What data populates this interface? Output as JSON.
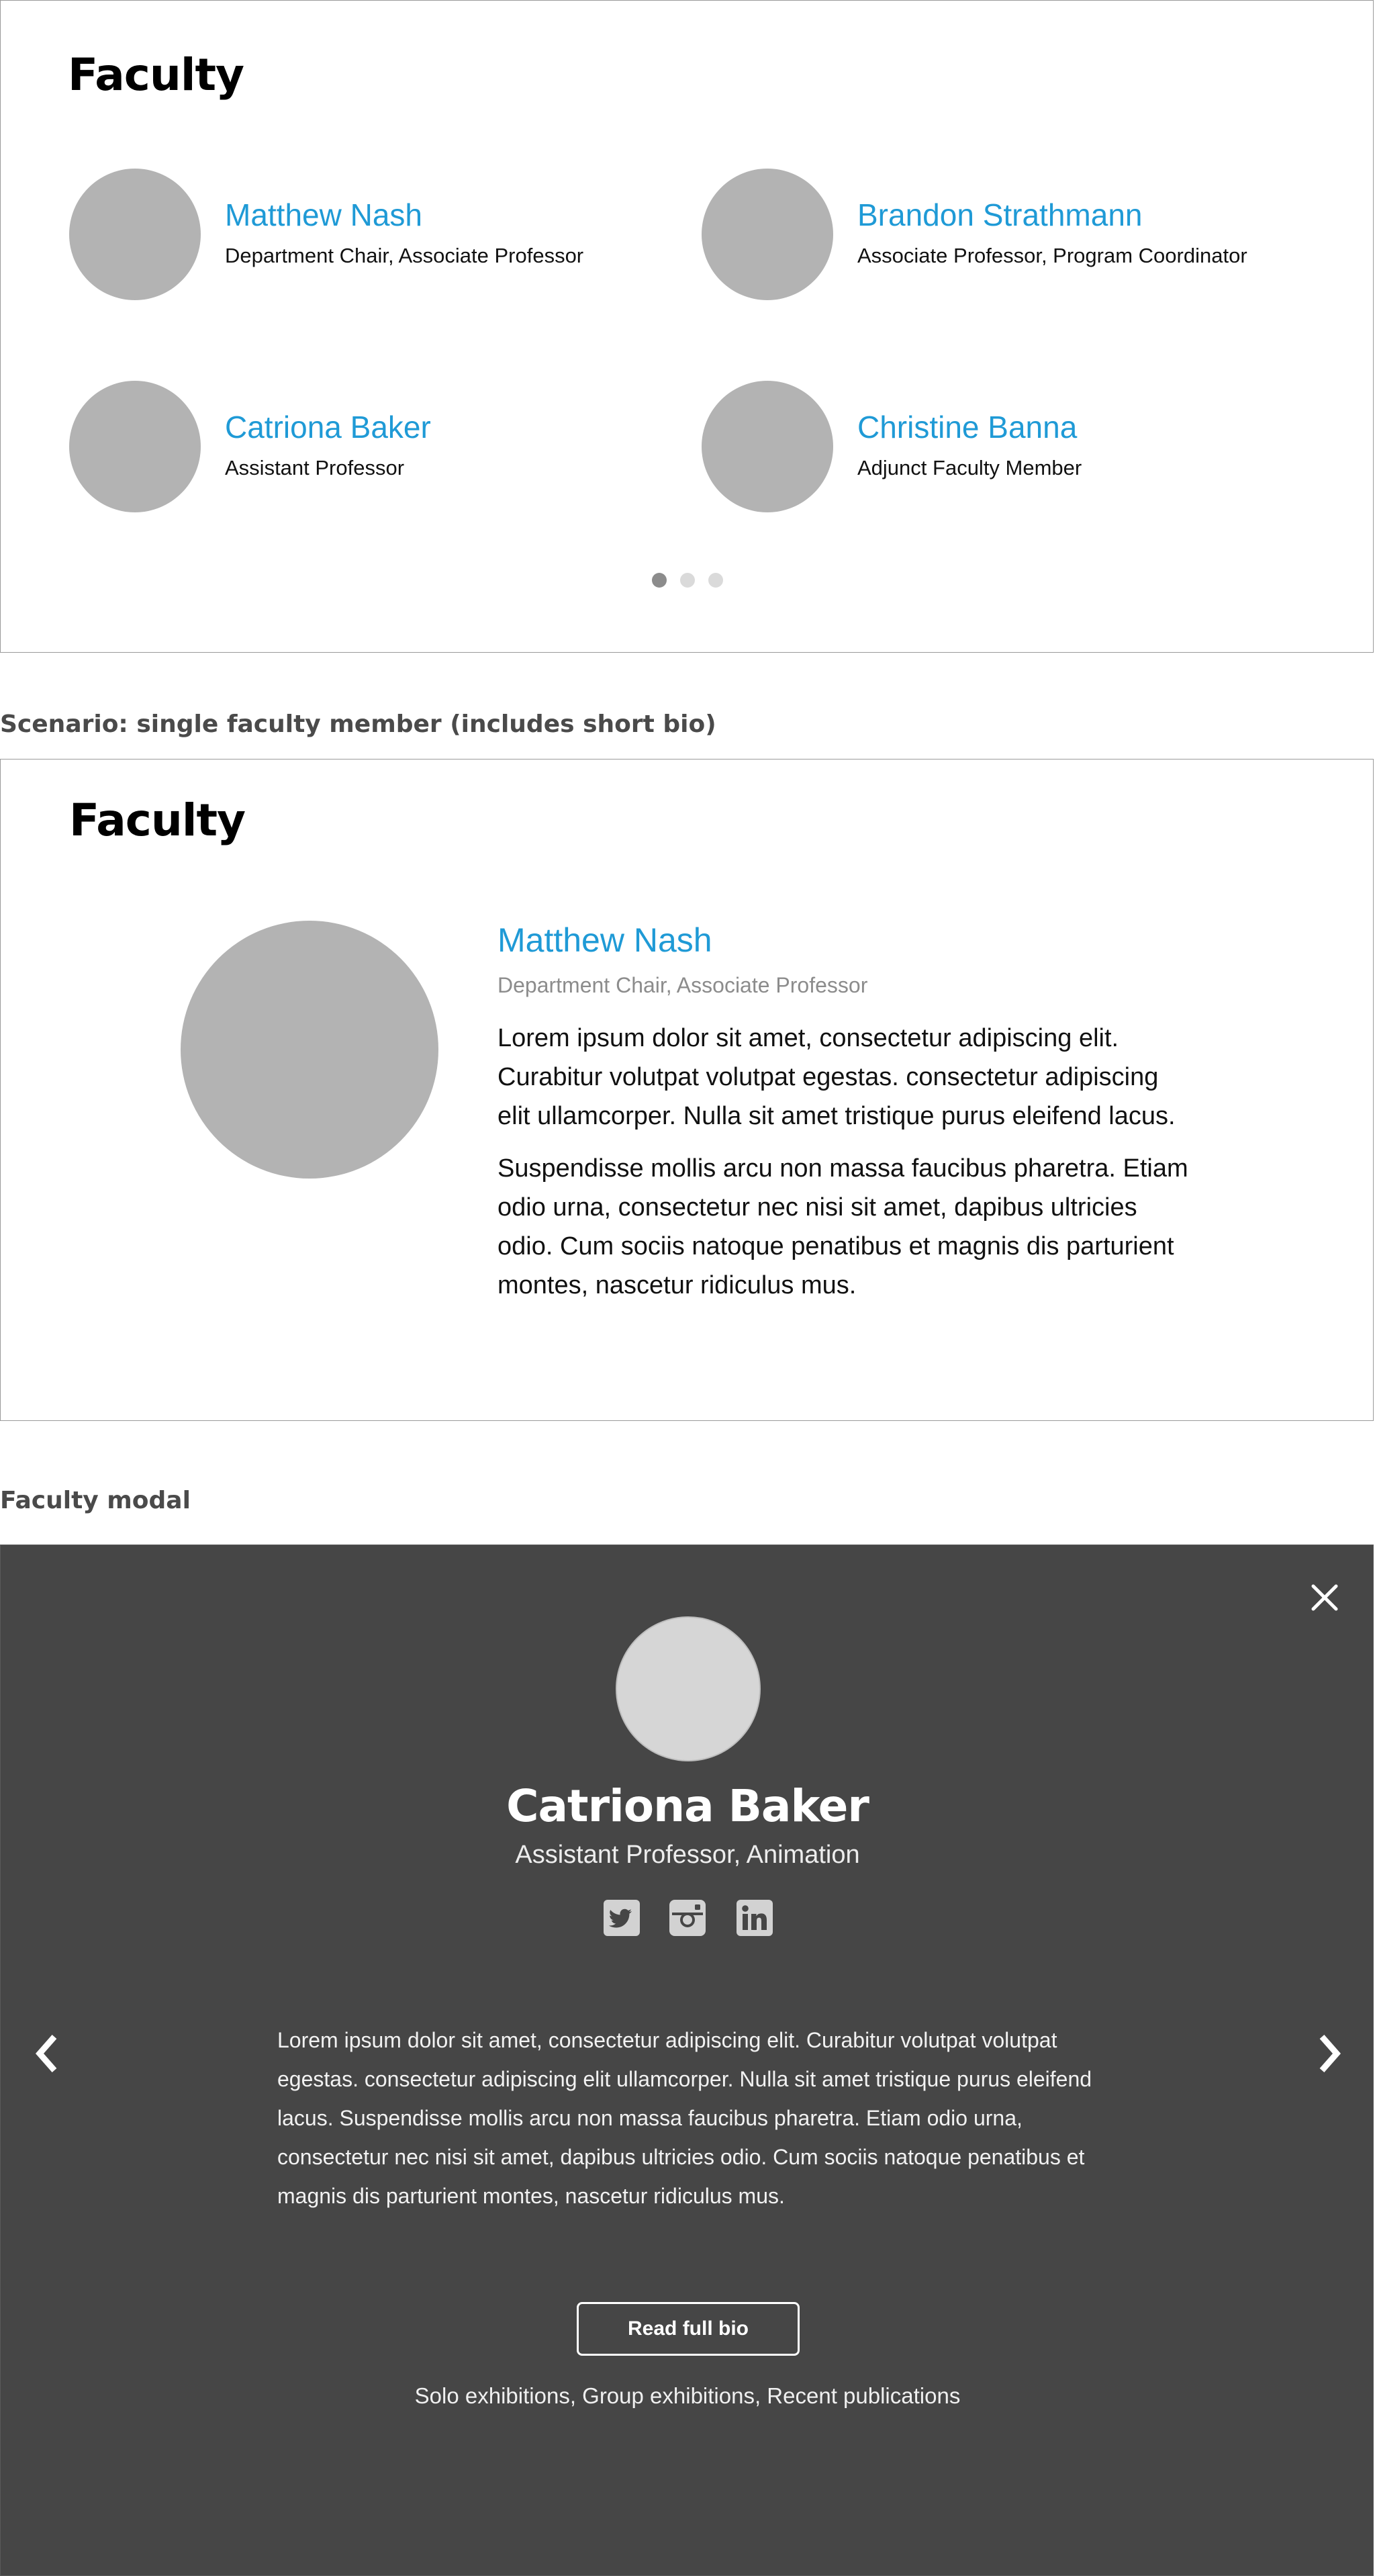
{
  "grid_section": {
    "title": "Faculty",
    "members": [
      {
        "name": "Matthew Nash",
        "role": "Department Chair, Associate Professor"
      },
      {
        "name": "Brandon Strathmann",
        "role": "Associate Professor, Program Coordinator"
      },
      {
        "name": "Catriona Baker",
        "role": "Assistant Professor"
      },
      {
        "name": "Christine Banna",
        "role": "Adjunct Faculty Member"
      }
    ],
    "pagination": {
      "pages": 3,
      "current": 1
    }
  },
  "single_section": {
    "label": "Scenario: single faculty member (includes short bio)",
    "title": "Faculty",
    "name": "Matthew Nash",
    "role": "Department Chair, Associate Professor",
    "bio": [
      "Lorem ipsum dolor sit amet, consectetur adipiscing elit. Curabitur volutpat volutpat egestas. consectetur adipiscing elit ullamcorper. Nulla sit amet tristique purus eleifend lacus.",
      "Suspendisse mollis arcu non massa faucibus pharetra. Etiam odio urna, consectetur nec nisi sit amet, dapibus ultricies odio. Cum sociis natoque penatibus et magnis dis parturient montes, nascetur ridiculus mus."
    ]
  },
  "modal_section": {
    "label": "Faculty modal",
    "name": "Catriona Baker",
    "role": "Assistant Professor, Animation",
    "bio": "Lorem ipsum dolor sit amet, consectetur adipiscing elit. Curabitur volutpat volutpat egestas. consectetur adipiscing elit ullamcorper. Nulla sit amet tristique purus eleifend lacus. Suspendisse mollis arcu non massa faucibus pharetra. Etiam odio urna, consectetur nec nisi sit amet, dapibus ultricies odio. Cum sociis natoque penatibus et magnis dis parturient montes, nascetur ridiculus mus.",
    "read_button": "Read full bio",
    "links": "Solo exhibitions, Group exhibitions, Recent publications",
    "social_icons": [
      "twitter-icon",
      "instagram-icon",
      "linkedin-icon"
    ],
    "background": "#464646"
  },
  "colors": {
    "name_link": "#1f9ad6",
    "avatar_placeholder": "#b3b3b3",
    "modal_avatar": "#d6d6d6",
    "dot_active": "#8c8c8c",
    "dot_inactive": "#dadada"
  }
}
